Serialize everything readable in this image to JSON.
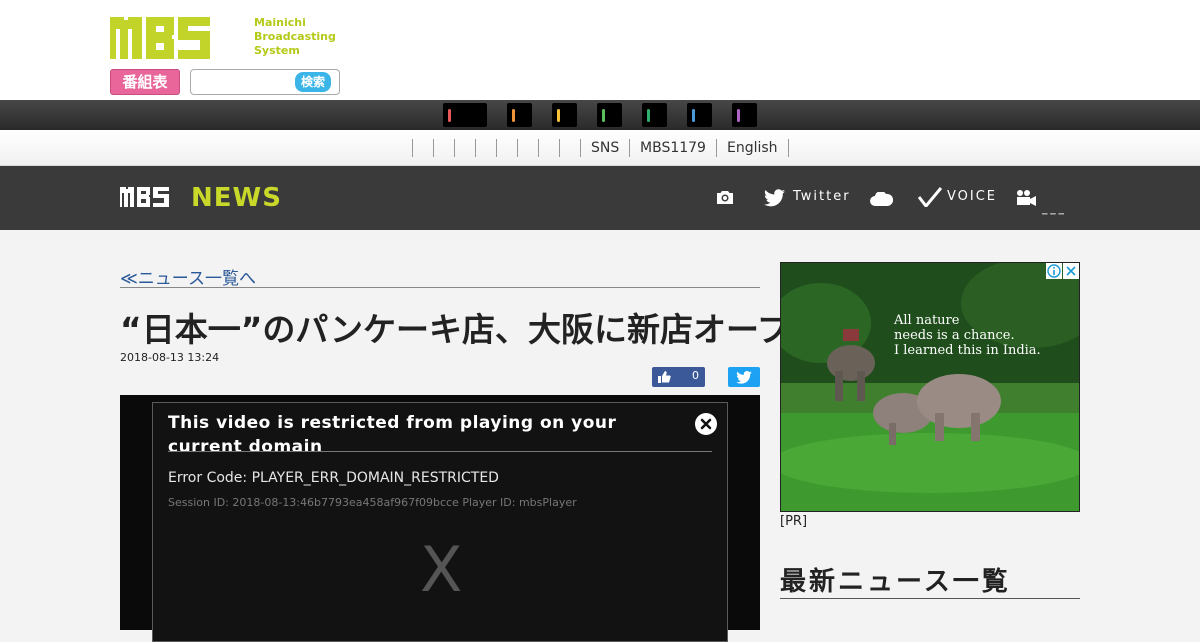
{
  "header": {
    "logo_text": "MBS",
    "logo_sub": [
      "Mainichi",
      "Broadcasting",
      "System"
    ],
    "bangumi_label": "番組表",
    "search_placeholder": "",
    "search_button": "検索"
  },
  "channel_bar": {
    "channels": [
      {
        "name": "channel-1",
        "color": "#e85a5a"
      },
      {
        "name": "channel-2",
        "color": "#f0943a"
      },
      {
        "name": "channel-3",
        "color": "#f5c23a"
      },
      {
        "name": "channel-4",
        "color": "#5cc05c"
      },
      {
        "name": "channel-5",
        "color": "#2fae6e"
      },
      {
        "name": "channel-6",
        "color": "#4a9ad8"
      },
      {
        "name": "channel-7",
        "color": "#b064c8"
      }
    ]
  },
  "sub_nav": {
    "items": [
      "SNS",
      "MBS1179",
      "English"
    ]
  },
  "news_bar": {
    "logo_mbs": "MBS",
    "logo_news": "NEWS",
    "twitter_label": "Twitter",
    "voice_label": "VOICE",
    "colors": {
      "accent": "#c8d92a",
      "bar_bg": "#3a3a3a"
    }
  },
  "article": {
    "back_link": "≪ニュース一覧へ",
    "title": "“日本一”のパンケーキ店、大阪に新店オープン",
    "date": "2018-08-13 13:24",
    "like_count": "0"
  },
  "player": {
    "error_title": "This video is restricted from playing on your current domain",
    "error_code": "Error Code: PLAYER_ERR_DOMAIN_RESTRICTED",
    "session": "Session ID: 2018-08-13:46b7793ea458af967f09bcce Player ID: mbsPlayer",
    "placeholder_glyph": "X"
  },
  "sidebar": {
    "ad_text": [
      "All nature",
      "needs is a chance.",
      "I learned this in India."
    ],
    "pr_label": "[PR]",
    "heading": "最新ニュース一覧"
  }
}
